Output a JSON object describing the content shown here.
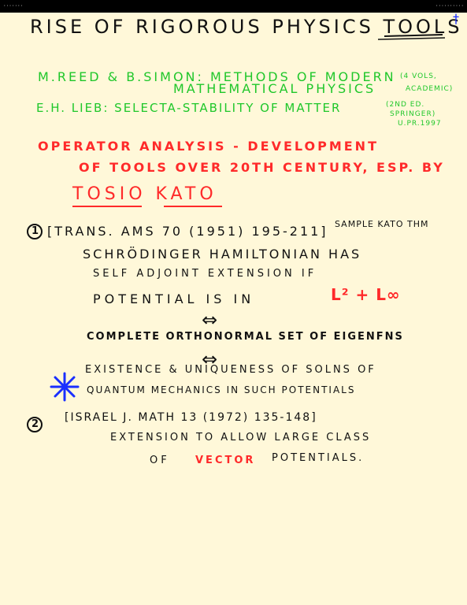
{
  "window": {
    "left_text": "·······",
    "right_text": "··········"
  },
  "title": {
    "text": "RISE OF RIGOROUS PHYSICS TOOLS",
    "mark": "†"
  },
  "refs": {
    "reed_simon_1": "M.REED & B.SIMON: METHODS OF MODERN",
    "reed_simon_2": "MATHEMATICAL PHYSICS",
    "reed_simon_note_1": "(4 VOLS,",
    "reed_simon_note_2": "ACADEMIC)",
    "lieb": "E.H. LIEB: SELECTA-STABILITY OF MATTER",
    "lieb_note_1": "(2ND ED.",
    "lieb_note_2": "SPRINGER)",
    "lieb_note_3": "U.PR.1997"
  },
  "operator": {
    "line1": "OPERATOR ANALYSIS - DEVELOPMENT",
    "line2": "OF TOOLS OVER 20TH CENTURY, ESP. BY",
    "name": "TOSIO KATO"
  },
  "item1": {
    "number": "1",
    "citation": "[TRANS. AMS 70 (1951) 195-211]",
    "sample": "SAMPLE KATO THM",
    "line1": "SCHRÖDINGER HAMILTONIAN HAS",
    "line2": "SELF ADJOINT EXTENSION IF",
    "line3": "POTENTIAL IS IN",
    "space": "L² + L∞",
    "arrow": "⇔",
    "line4": "COMPLETE ORTHONORMAL SET OF EIGENFNS",
    "line5": "EXISTENCE & UNIQUENESS OF SOLNS OF",
    "line6": "QUANTUM MECHANICS IN SUCH POTENTIALS"
  },
  "item2": {
    "number": "2",
    "citation": "[ISRAEL J. MATH 13 (1972) 135-148]",
    "line1": "EXTENSION TO ALLOW LARGE CLASS",
    "line2_pre": "OF",
    "vector": "VECTOR",
    "line2_post": "POTENTIALS."
  },
  "colors": {
    "paper": "#fff8d9",
    "ink": "#111111",
    "green": "#1fc72a",
    "red": "#ff2a2a",
    "blue": "#1a2fff"
  }
}
